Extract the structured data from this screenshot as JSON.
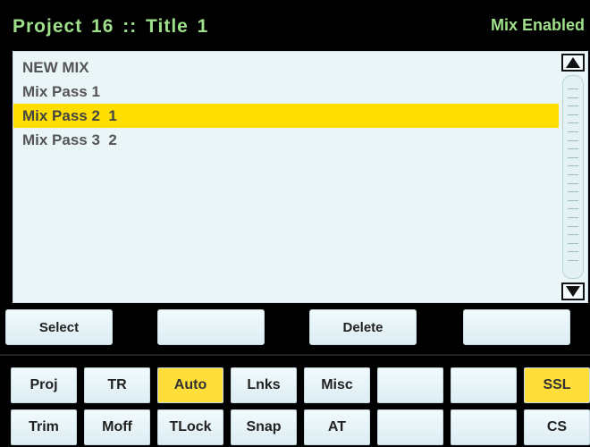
{
  "header": {
    "title": "Project  16  ::  Title  1",
    "status": "Mix Enabled"
  },
  "mix_list": {
    "items": [
      {
        "label": "NEW MIX",
        "selected": false
      },
      {
        "label": "Mix Pass 1",
        "selected": false
      },
      {
        "label": "Mix Pass 2  1",
        "selected": true
      },
      {
        "label": "Mix Pass 3  2",
        "selected": false
      }
    ]
  },
  "softkeys": [
    "Select",
    "",
    "Delete",
    ""
  ],
  "bottom_keys": {
    "row1": [
      {
        "label": "Proj",
        "active": false
      },
      {
        "label": "TR",
        "active": false
      },
      {
        "label": "Auto",
        "active": true
      },
      {
        "label": "Lnks",
        "active": false
      },
      {
        "label": "Misc",
        "active": false
      },
      {
        "label": "",
        "active": false
      },
      {
        "label": "",
        "active": false
      },
      {
        "label": "SSL",
        "active": true
      }
    ],
    "row2": [
      {
        "label": "Trim",
        "active": false
      },
      {
        "label": "Moff",
        "active": false
      },
      {
        "label": "TLock",
        "active": false
      },
      {
        "label": "Snap",
        "active": false
      },
      {
        "label": "AT",
        "active": false
      },
      {
        "label": "",
        "active": false
      },
      {
        "label": "",
        "active": false
      },
      {
        "label": "CS",
        "active": false
      }
    ]
  },
  "colors": {
    "title_green": "#9fe08a",
    "highlight_yellow": "#ffde00",
    "panel_bg": "#eaf5f8",
    "background": "#000000"
  }
}
